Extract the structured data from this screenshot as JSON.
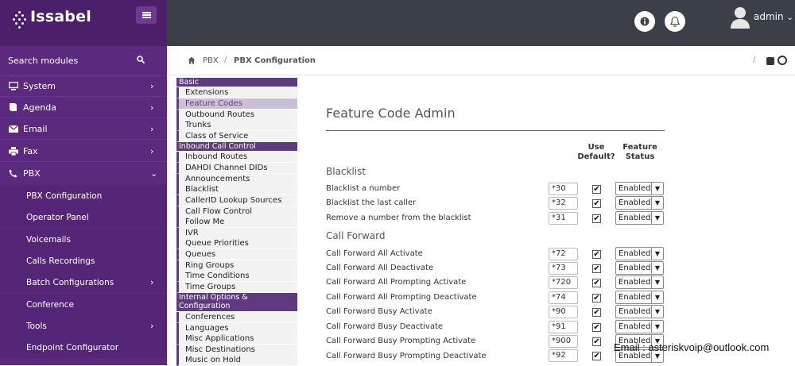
{
  "brand": {
    "name": "Issabel"
  },
  "search": {
    "label": "Search modules"
  },
  "sidebar": {
    "items": [
      {
        "label": "System",
        "icon": "monitor-icon"
      },
      {
        "label": "Agenda",
        "icon": "book-icon"
      },
      {
        "label": "Email",
        "icon": "envelope-icon"
      },
      {
        "label": "Fax",
        "icon": "printer-icon"
      },
      {
        "label": "PBX",
        "icon": "phone-icon"
      }
    ],
    "pbx_sub": [
      "PBX Configuration",
      "Operator Panel",
      "Voicemails",
      "Calls Recordings",
      "Batch Configurations",
      "Conference",
      "Tools",
      "Endpoint Configurator"
    ]
  },
  "topbar": {
    "user": "admin"
  },
  "breadcrumb": {
    "home": "PBX",
    "current": "PBX Configuration"
  },
  "modules": {
    "basic_head": "Basic",
    "basic": [
      "Extensions",
      "Feature Codes",
      "Outbound Routes",
      "Trunks",
      "Class of Service"
    ],
    "inbound_head": "Inbound Call Control",
    "inbound": [
      "Inbound Routes",
      "DAHDI Channel DIDs",
      "Announcements",
      "Blacklist",
      "CallerID Lookup Sources",
      "Call Flow Control",
      "Follow Me",
      "IVR",
      "Queue Priorities",
      "Queues",
      "Ring Groups",
      "Time Conditions",
      "Time Groups"
    ],
    "internal_head_1": "Internal Options &",
    "internal_head_2": "Configuration",
    "internal": [
      "Conferences",
      "Languages",
      "Misc Applications",
      "Misc Destinations",
      "Music on Hold"
    ]
  },
  "form": {
    "title": "Feature Code Admin",
    "col_use_default_1": "Use",
    "col_use_default_2": "Default?",
    "col_status_1": "Feature",
    "col_status_2": "Status",
    "sections": [
      {
        "name": "Blacklist",
        "rows": [
          {
            "label": "Blacklist a number",
            "code": "*30",
            "status": "Enabled"
          },
          {
            "label": "Blacklist the last caller",
            "code": "*32",
            "status": "Enabled"
          },
          {
            "label": "Remove a number from the blacklist",
            "code": "*31",
            "status": "Enabled"
          }
        ]
      },
      {
        "name": "Call Forward",
        "rows": [
          {
            "label": "Call Forward All Activate",
            "code": "*72",
            "status": "Enabled"
          },
          {
            "label": "Call Forward All Deactivate",
            "code": "*73",
            "status": "Enabled"
          },
          {
            "label": "Call Forward All Prompting Activate",
            "code": "*720",
            "status": "Enabled"
          },
          {
            "label": "Call Forward All Prompting Deactivate",
            "code": "*74",
            "status": "Enabled"
          },
          {
            "label": "Call Forward Busy Activate",
            "code": "*90",
            "status": "Enabled"
          },
          {
            "label": "Call Forward Busy Deactivate",
            "code": "*91",
            "status": "Enabled"
          },
          {
            "label": "Call Forward Busy Prompting Activate",
            "code": "*900",
            "status": "Enabled"
          },
          {
            "label": "Call Forward Busy Prompting Deactivate",
            "code": "*92",
            "status": "Enabled"
          }
        ]
      }
    ]
  },
  "watermark": {
    "email": "Email : asteriskvoip@outlook.com"
  }
}
